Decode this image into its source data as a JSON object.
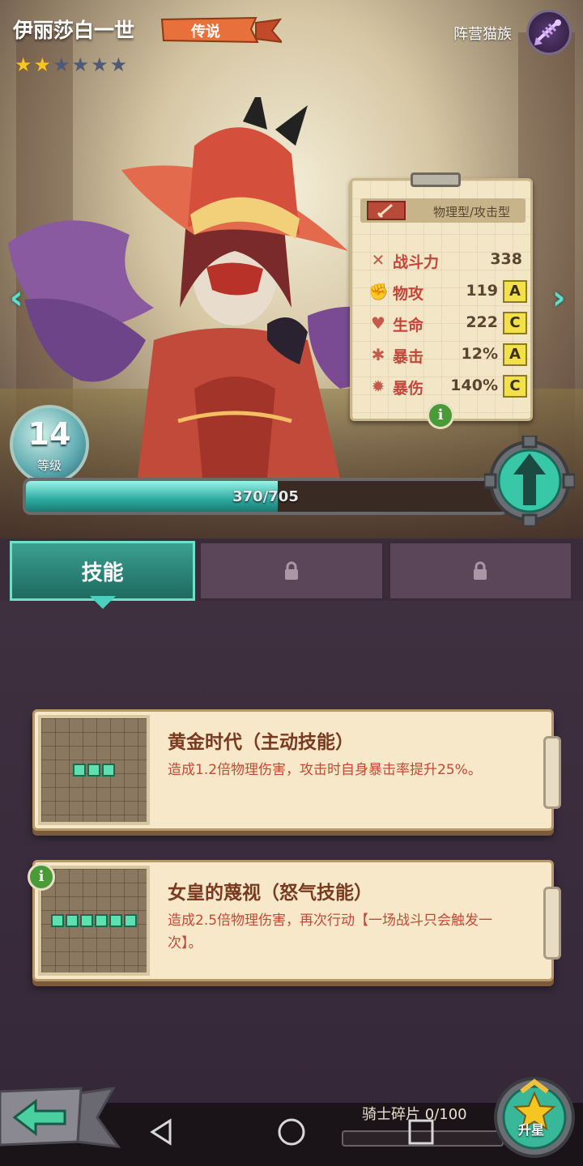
{
  "hero": {
    "name": "伊丽莎白一世",
    "rarity": "传说",
    "stars_filled": 2,
    "stars_total": 6
  },
  "faction": {
    "label": "阵营猫族",
    "icon": "fish-bone-icon"
  },
  "stats": {
    "type_label": "物理型/攻击型",
    "power": {
      "label": "战斗力",
      "value": "338"
    },
    "rows": [
      {
        "label": "物攻",
        "value": "119",
        "grade": "A",
        "icon": "fist-icon"
      },
      {
        "label": "生命",
        "value": "222",
        "grade": "C",
        "icon": "heart-icon"
      },
      {
        "label": "暴击",
        "value": "12%",
        "grade": "A",
        "icon": "crit-icon"
      },
      {
        "label": "暴伤",
        "value": "140%",
        "grade": "C",
        "icon": "crit-damage-icon"
      }
    ]
  },
  "level": {
    "value": "14",
    "label": "等级",
    "exp_text": "370/705",
    "exp_fraction": 0.525
  },
  "tabs": [
    {
      "label": "技能",
      "active": true,
      "locked": false
    },
    {
      "label": "",
      "active": false,
      "locked": true
    },
    {
      "label": "",
      "active": false,
      "locked": true
    }
  ],
  "skills": [
    {
      "name": "黄金时代（主动技能）",
      "desc": "造成1.2倍物理伤害，攻击时自身暴击率提升25%。",
      "segments": 3
    },
    {
      "name": "女皇的蔑视（怒气技能）",
      "desc": "造成2.5倍物理伤害，再次行动【一场战斗只会触发一次】。",
      "segments": 6
    }
  ],
  "shards": {
    "label": "骑士碎片 0/100",
    "fraction": 0
  },
  "star_up_label": "升星",
  "info_glyph": "i",
  "colors": {
    "accent_teal": "#2eaaa0",
    "grade_yellow": "#f4e04a",
    "stat_red": "#c4463a"
  }
}
